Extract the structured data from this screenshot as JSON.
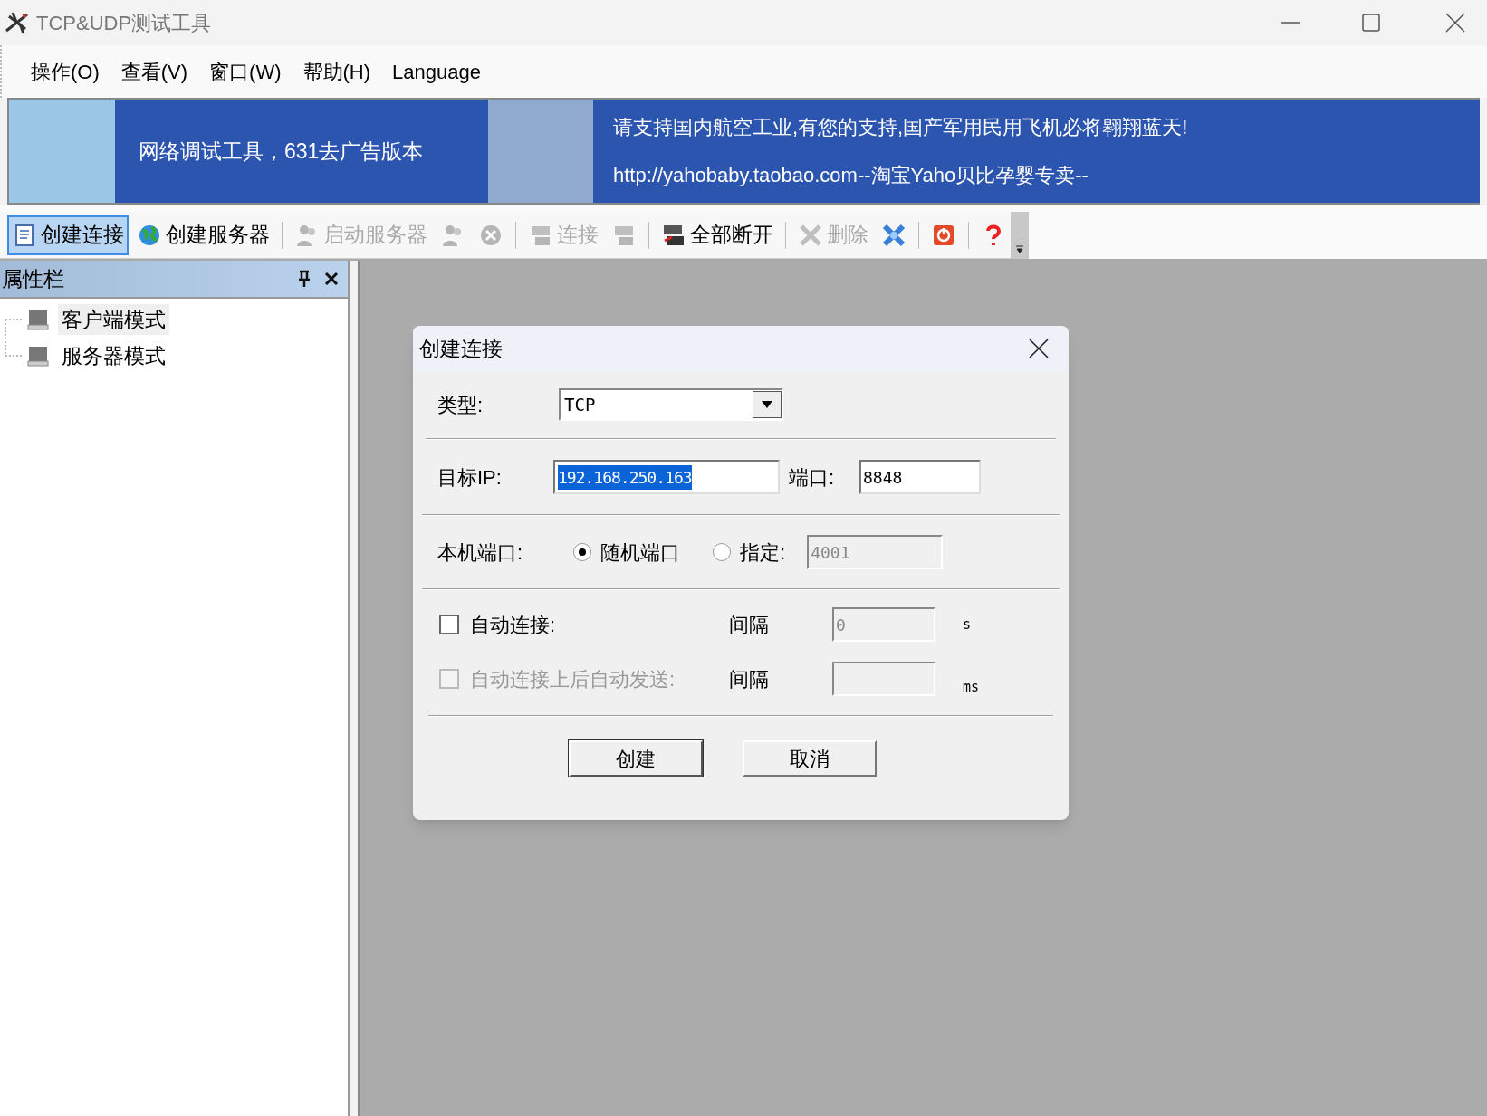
{
  "window": {
    "title": "TCP&UDP测试工具"
  },
  "menu": [
    {
      "label": "操作(O)"
    },
    {
      "label": "查看(V)"
    },
    {
      "label": "窗口(W)"
    },
    {
      "label": "帮助(H)"
    },
    {
      "label": "Language"
    }
  ],
  "banner": {
    "left_text": "网络调试工具，631去广告版本",
    "right_lines": [
      "请支持国内航空工业,有您的支持,国产军用民用飞机必将翱翔蓝天!",
      "http://yahobaby.taobao.com--淘宝Yaho贝比孕婴专卖--"
    ]
  },
  "toolbar": [
    {
      "kind": "button",
      "label": "创建连接",
      "disabled": false,
      "selected": true
    },
    {
      "kind": "button",
      "label": "创建服务器",
      "disabled": false,
      "selected": false
    },
    {
      "kind": "separator"
    },
    {
      "kind": "button",
      "label": "启动服务器",
      "disabled": true,
      "selected": false
    },
    {
      "kind": "button",
      "disabled": true,
      "selected": false
    },
    {
      "kind": "button",
      "disabled": true,
      "selected": false
    },
    {
      "kind": "separator"
    },
    {
      "kind": "button",
      "label": "连接",
      "disabled": true,
      "selected": false
    },
    {
      "kind": "button",
      "disabled": true,
      "selected": false
    },
    {
      "kind": "separator"
    },
    {
      "kind": "button",
      "label": "全部断开",
      "disabled": false,
      "selected": false
    },
    {
      "kind": "separator"
    },
    {
      "kind": "button",
      "label": "删除",
      "disabled": true,
      "selected": false
    },
    {
      "kind": "button",
      "disabled": false,
      "selected": false
    },
    {
      "kind": "separator"
    },
    {
      "kind": "button",
      "disabled": false,
      "selected": false
    },
    {
      "kind": "separator"
    },
    {
      "kind": "button",
      "disabled": false,
      "selected": false
    }
  ],
  "properties_panel": {
    "title": "属性栏",
    "tree": [
      {
        "label": "客户端模式",
        "selected": true
      },
      {
        "label": "服务器模式",
        "selected": false
      }
    ]
  },
  "dialog": {
    "title": "创建连接",
    "type_label": "类型:",
    "type_value": "TCP",
    "ip_label": "目标IP:",
    "ip_value": "192.168.250.163",
    "port_label": "端口:",
    "port_value": "8848",
    "local_port_label": "本机端口:",
    "local_port_options": [
      {
        "label": "随机端口",
        "selected": true
      },
      {
        "label": "指定:",
        "selected": false
      }
    ],
    "local_port_value": "4001",
    "local_port_disabled": true,
    "auto_connect": {
      "label": "自动连接:",
      "checked": false,
      "disabled": false,
      "interval_label": "间隔",
      "interval_value": "0",
      "unit": "s"
    },
    "auto_send": {
      "label": "自动连接上后自动发送:",
      "checked": false,
      "disabled": true,
      "interval_label": "间隔",
      "unit": "ms"
    },
    "buttons": [
      {
        "label": "创建",
        "default": true
      },
      {
        "label": "取消",
        "default": false
      }
    ]
  }
}
